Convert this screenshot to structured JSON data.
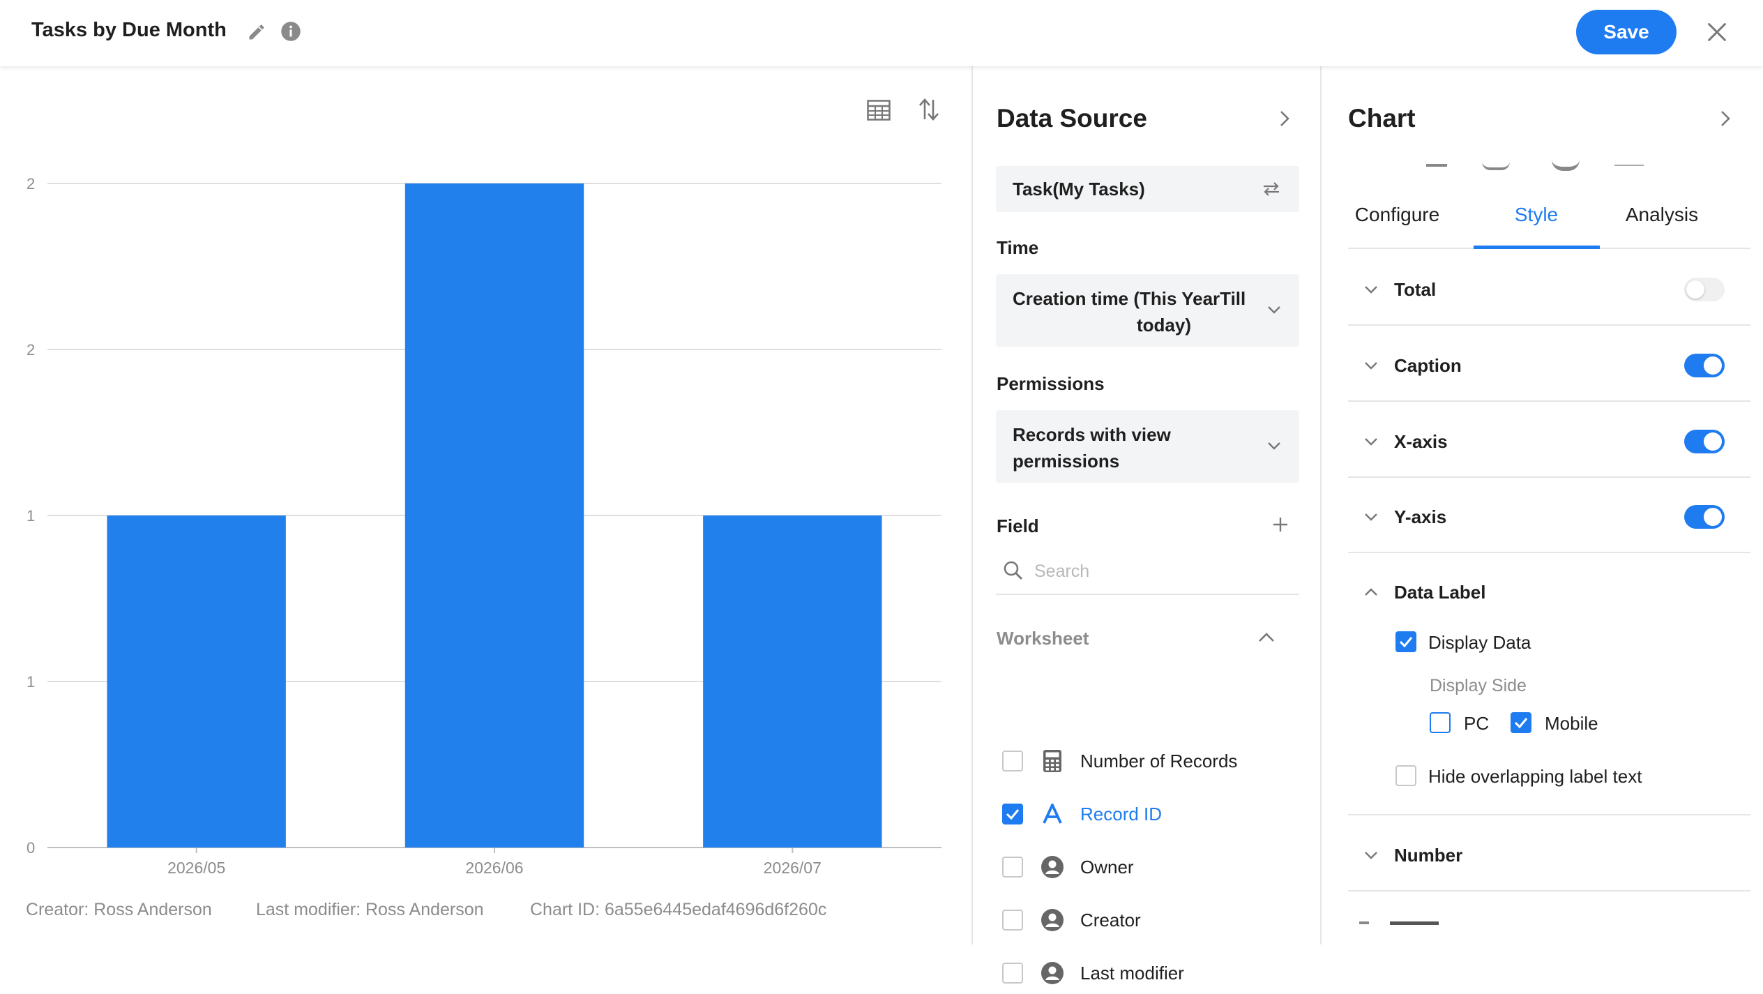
{
  "header": {
    "title": "Tasks by Due Month",
    "save_label": "Save"
  },
  "icons": {
    "edit": "pencil-icon",
    "info": "info-icon",
    "close": "close-icon",
    "table": "table-icon",
    "sort": "sort-icon",
    "swap": "swap-icon",
    "chevron_down": "chevron-down-icon",
    "chevron_right": "chevron-right-icon",
    "plus": "plus-icon",
    "search": "search-icon"
  },
  "colors": {
    "accent": "#1e7cf0",
    "bar": "#2280ec"
  },
  "chart_data": {
    "type": "bar",
    "categories": [
      "2026/05",
      "2026/06",
      "2026/07"
    ],
    "values": [
      1,
      2,
      1
    ],
    "y_tick_labels": [
      "0",
      "1",
      "1",
      "2",
      "2"
    ],
    "ylim": [
      0,
      2
    ],
    "grid": true,
    "legend": "none"
  },
  "footer": {
    "creator": "Creator: Ross Anderson",
    "modifier": "Last modifier: Ross Anderson",
    "chart_id": "Chart ID: 6a55e6445edaf4696d6f260c"
  },
  "data_source": {
    "title": "Data Source",
    "source": "Task(My Tasks)",
    "time_label": "Time",
    "time_value_line1": "Creation time  (This YearTill",
    "time_value_line2": "today)",
    "permissions_label": "Permissions",
    "permissions_line1": "Records with view",
    "permissions_line2": "permissions",
    "field_label": "Field",
    "search_placeholder": "Search",
    "worksheet_label": "Worksheet",
    "fields": [
      {
        "label": "Number of Records",
        "checked": false,
        "icon": "calculator-icon"
      },
      {
        "label": "Record ID",
        "checked": true,
        "icon": "text-a-icon"
      },
      {
        "label": "Owner",
        "checked": false,
        "icon": "user-icon"
      },
      {
        "label": "Creator",
        "checked": false,
        "icon": "user-icon"
      },
      {
        "label": "Last modifier",
        "checked": false,
        "icon": "user-icon"
      }
    ]
  },
  "chart_panel": {
    "title": "Chart",
    "tabs": [
      "Configure",
      "Style",
      "Analysis"
    ],
    "active_tab": "Style",
    "sections": {
      "total": {
        "label": "Total",
        "on": false
      },
      "caption": {
        "label": "Caption",
        "on": true
      },
      "xaxis": {
        "label": "X-axis",
        "on": true
      },
      "yaxis": {
        "label": "Y-axis",
        "on": true
      },
      "data_label": {
        "label": "Data Label",
        "expanded": true
      },
      "number": {
        "label": "Number"
      }
    },
    "data_label": {
      "display_data": "Display Data",
      "display_side": "Display Side",
      "pc": "PC",
      "mobile": "Mobile",
      "hide_overlap": "Hide overlapping label text"
    }
  }
}
